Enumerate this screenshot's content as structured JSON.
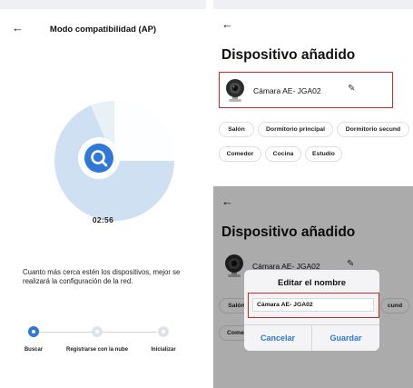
{
  "colors": {
    "accent": "#2e78d8",
    "highlight": "#d8262b",
    "radar": "#cfe0f2"
  },
  "left": {
    "back_icon": "arrow-left-icon",
    "title": "Modo compatibilidad (AP)",
    "timer": "02:56",
    "hint": "Cuanto más cerca estén los dispositivos, mejor se realizará la configuración de la red.",
    "steps": [
      {
        "label": "Buscar",
        "state": "active"
      },
      {
        "label": "Registrarse con la nube",
        "state": "pending"
      },
      {
        "label": "Inicializar",
        "state": "pending"
      }
    ]
  },
  "right_top": {
    "back_icon": "arrow-left-icon",
    "title": "Dispositivo añadido",
    "device_name": "Cámara AE- JGA02",
    "edit_icon": "pencil-icon",
    "rooms": [
      "Salón",
      "Dormitorio principal",
      "Dormitorio secund",
      "Comedor",
      "Cocina",
      "Estudio"
    ]
  },
  "right_bottom": {
    "back_icon": "arrow-left-icon",
    "title": "Dispositivo añadido",
    "device_name": "Cámara AE- JGA02",
    "rooms_visible": [
      "Salón",
      "cund",
      "Come"
    ],
    "dialog": {
      "title": "Editar el nombre",
      "input_value": "Cámara AE- JGA02",
      "cancel_label": "Cancelar",
      "save_label": "Guardar"
    }
  }
}
